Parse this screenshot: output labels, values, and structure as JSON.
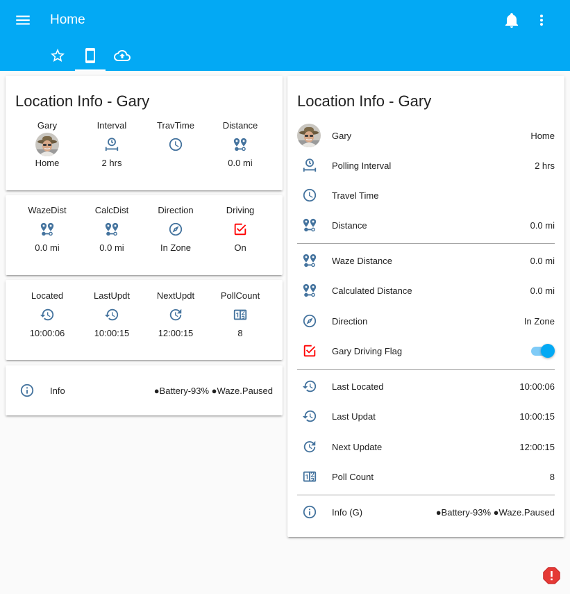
{
  "header": {
    "title": "Home",
    "accent_color": "#03a9f4",
    "icons": {
      "menu": "menu-icon",
      "notifications": "bell-icon",
      "more": "more-vert-icon"
    },
    "tabs": [
      {
        "icon": "star-outline-icon",
        "active": false
      },
      {
        "icon": "cellphone-icon",
        "active": true
      },
      {
        "icon": "cloud-upload-icon",
        "active": false
      }
    ]
  },
  "left": {
    "title": "Location Info - Gary",
    "group1": [
      {
        "label": "Gary",
        "icon": "avatar",
        "state": "Home"
      },
      {
        "label": "Interval",
        "icon": "timer-interval-icon",
        "state": "2 hrs"
      },
      {
        "label": "TravTime",
        "icon": "clock-icon",
        "state": ""
      },
      {
        "label": "Distance",
        "icon": "map-marker-distance-icon",
        "state": "0.0 mi"
      }
    ],
    "group2": [
      {
        "label": "WazeDist",
        "icon": "map-marker-distance-icon",
        "state": "0.0 mi"
      },
      {
        "label": "CalcDist",
        "icon": "map-marker-distance-icon",
        "state": "0.0 mi"
      },
      {
        "label": "Direction",
        "icon": "compass-icon",
        "state": "In Zone"
      },
      {
        "label": "Driving",
        "icon": "checkbox-marked-icon",
        "state": "On"
      }
    ],
    "group3": [
      {
        "label": "Located",
        "icon": "history-icon",
        "state": "10:00:06"
      },
      {
        "label": "LastUpdt",
        "icon": "history-icon",
        "state": "10:00:15"
      },
      {
        "label": "NextUpdt",
        "icon": "update-icon",
        "state": "12:00:15"
      },
      {
        "label": "PollCount",
        "icon": "counter-icon",
        "state": "8"
      }
    ],
    "info": {
      "label": "Info",
      "icon": "info-icon",
      "state": "●Battery-93% ●Waze.Paused"
    }
  },
  "right": {
    "title": "Location Info - Gary",
    "rows": [
      {
        "label": "Gary",
        "icon": "avatar",
        "state": "Home"
      },
      {
        "label": "Polling Interval",
        "icon": "timer-interval-icon",
        "state": "2 hrs"
      },
      {
        "label": "Travel Time",
        "icon": "clock-icon",
        "state": ""
      },
      {
        "label": "Distance",
        "icon": "map-marker-distance-icon",
        "state": "0.0 mi"
      },
      {
        "label": "Waze Distance",
        "icon": "map-marker-distance-icon",
        "state": "0.0 mi"
      },
      {
        "label": "Calculated Distance",
        "icon": "map-marker-distance-icon",
        "state": "0.0 mi"
      },
      {
        "label": "Direction",
        "icon": "compass-icon",
        "state": "In Zone"
      },
      {
        "label": "Gary Driving Flag",
        "icon": "checkbox-marked-icon",
        "state": "on"
      },
      {
        "label": "Last Located",
        "icon": "history-icon",
        "state": "10:00:06"
      },
      {
        "label": "Last Updat",
        "icon": "history-icon",
        "state": "10:00:15"
      },
      {
        "label": "Next Update",
        "icon": "update-icon",
        "state": "12:00:15"
      },
      {
        "label": "Poll Count",
        "icon": "counter-icon",
        "state": "8"
      },
      {
        "label": "Info (G)",
        "icon": "info-icon",
        "state": "●Battery-93% ●Waze.Paused"
      }
    ]
  },
  "colors": {
    "icon": "#44739e",
    "driving_on": "#ff0000",
    "alert": "#db4437"
  },
  "alert_icon": "alert-octagon-icon"
}
